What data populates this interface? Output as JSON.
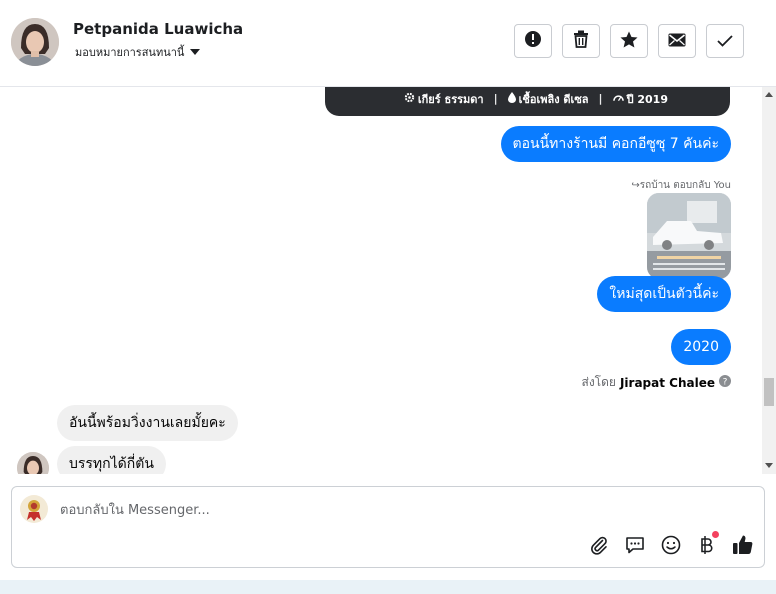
{
  "header": {
    "contact_name": "Petpanida Luawicha",
    "assign_label": "มอบหมายการสนทนานี้",
    "actions": [
      {
        "name": "report-button",
        "icon": "alert-circle-icon"
      },
      {
        "name": "delete-button",
        "icon": "trash-icon"
      },
      {
        "name": "star-button",
        "icon": "star-icon"
      },
      {
        "name": "mark-unread-button",
        "icon": "envelope-icon"
      },
      {
        "name": "mark-done-button",
        "icon": "checkmark-icon"
      }
    ]
  },
  "listing_card": {
    "gear": "เกียร์ ธรรมดา",
    "fuel": "เชื้อเพลิง ดีเซล",
    "year": "ปี 2019"
  },
  "messages": {
    "out_1": "ตอนนี้ทางร้านมี คอกอีซูซุ 7 คันค่ะ",
    "reply_label": "รถบ้าน ตอบกลับ You",
    "out_2": "ใหม่สุดเป็นตัวนี้ค่ะ",
    "out_3": "2020",
    "sent_by_prefix": "ส่งโดย",
    "sent_by_name": "Jirapat Chalee",
    "in_1": "อันนี้พร้อมวิ่งงานเลยมั้ยคะ",
    "in_2": "บรรทุกได้กี่ตัน"
  },
  "composer": {
    "placeholder": "ตอบกลับใน Messenger...",
    "icons": [
      "paperclip-icon",
      "saved-reply-icon",
      "emoji-icon",
      "payment-baht-icon",
      "like-thumb-icon"
    ]
  },
  "colors": {
    "outgoing_bubble": "#0a7cff",
    "incoming_bubble": "#f0f0f0",
    "listing_card": "#2b2d31",
    "notification_dot": "#f3425f"
  }
}
